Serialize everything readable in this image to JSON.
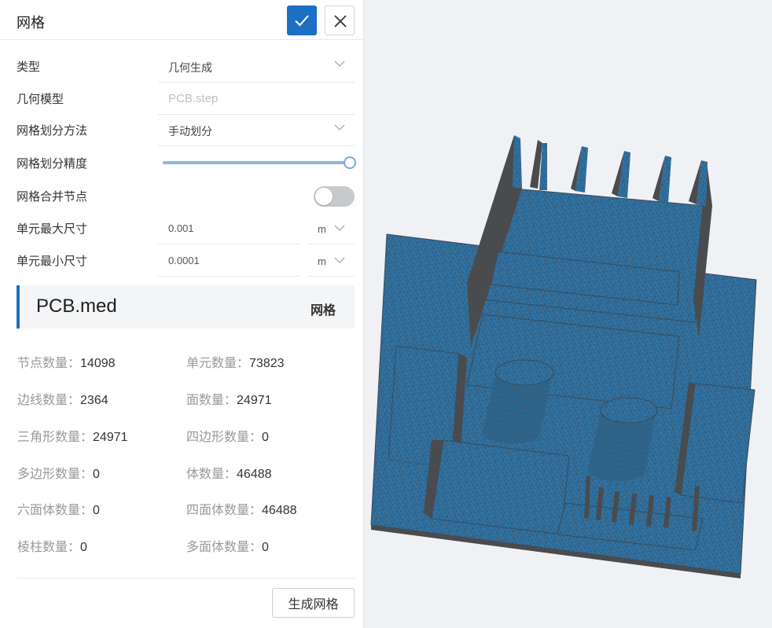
{
  "panel": {
    "title": "网格",
    "confirm_icon": "check-icon",
    "close_icon": "close-icon"
  },
  "form": {
    "type": {
      "label": "类型",
      "value": "几何生成"
    },
    "geometry": {
      "label": "几何模型",
      "placeholder": "PCB.step"
    },
    "method": {
      "label": "网格划分方法",
      "value": "手动划分"
    },
    "precision": {
      "label": "网格划分精度",
      "level": 1.0
    },
    "merge": {
      "label": "网格合并节点",
      "on": false
    },
    "max_size": {
      "label": "单元最大尺寸",
      "value": "0.001",
      "unit": "m"
    },
    "min_size": {
      "label": "单元最小尺寸",
      "value": "0.0001",
      "unit": "m"
    }
  },
  "file": {
    "name": "PCB.med",
    "tag": "网格"
  },
  "stats": [
    {
      "label": "节点数量：",
      "value": "14098"
    },
    {
      "label": "单元数量：",
      "value": "73823"
    },
    {
      "label": "边线数量：",
      "value": "2364"
    },
    {
      "label": "面数量：",
      "value": "24971"
    },
    {
      "label": "三角形数量：",
      "value": "24971"
    },
    {
      "label": "四边形数量：",
      "value": "0"
    },
    {
      "label": "多边形数量：",
      "value": "0"
    },
    {
      "label": "体数量：",
      "value": "46488"
    },
    {
      "label": "六面体数量：",
      "value": "0"
    },
    {
      "label": "四面体数量：",
      "value": "46488"
    },
    {
      "label": "棱柱数量：",
      "value": "0"
    },
    {
      "label": "多面体数量：",
      "value": "0"
    }
  ],
  "actions": {
    "generate": "生成网格"
  },
  "colors": {
    "accent": "#1d6fc4",
    "mesh_face": "#2c74a8",
    "mesh_side": "#4a4b4d"
  }
}
